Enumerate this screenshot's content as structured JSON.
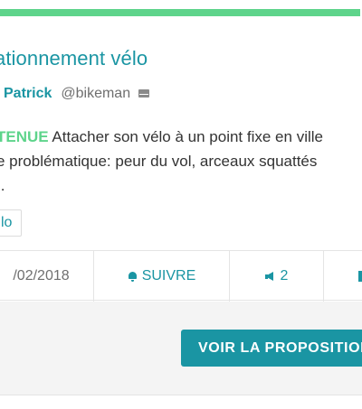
{
  "proposal": {
    "title": "ationnement vélo",
    "author_name": "Patrick",
    "author_handle": "@bikeman",
    "status": "TENUE",
    "excerpt_line1": " Attacher son vélo à un point fixe en ville",
    "excerpt_line2": "e problématique: peur du vol, arceaux squattés",
    "excerpt_line3": "..",
    "tag": "lo",
    "accent_color": "#1a95a3",
    "status_color": "#5ed48b"
  },
  "meta": {
    "date": "/02/2018",
    "follow_label": "SUIVRE",
    "votes": "2"
  },
  "footer": {
    "cta_label": "VOIR LA PROPOSITION"
  },
  "icons": [
    "mail-icon",
    "bell-icon",
    "megaphone-icon"
  ]
}
